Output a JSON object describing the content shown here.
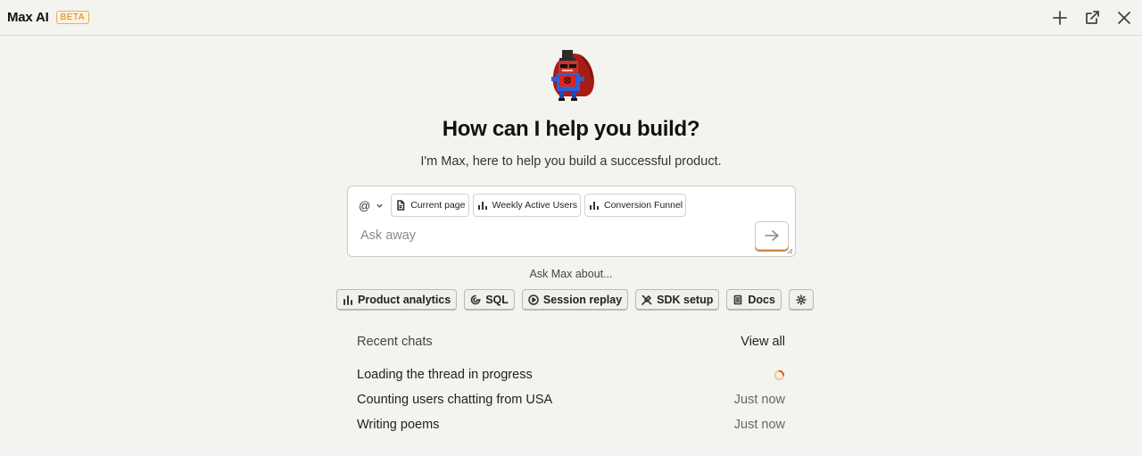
{
  "header": {
    "title": "Max AI",
    "badge": "BETA",
    "actions": [
      "plus-icon",
      "open-external-icon",
      "close-icon"
    ]
  },
  "hero": {
    "headline": "How can I help you build?",
    "subline": "I'm Max, here to help you build a successful product."
  },
  "input": {
    "mention_label": "@",
    "context_chips": [
      {
        "label": "Current page",
        "icon": "document-icon"
      },
      {
        "label": "Weekly Active Users",
        "icon": "bar-chart-icon"
      },
      {
        "label": "Conversion Funnel",
        "icon": "bar-chart-icon"
      }
    ],
    "placeholder": "Ask away"
  },
  "suggestions": {
    "heading": "Ask Max about...",
    "items": [
      {
        "label": "Product analytics",
        "icon": "bar-chart-icon"
      },
      {
        "label": "SQL",
        "icon": "database-icon"
      },
      {
        "label": "Session replay",
        "icon": "play-icon"
      },
      {
        "label": "SDK setup",
        "icon": "plug-icon"
      },
      {
        "label": "Docs",
        "icon": "book-icon"
      },
      {
        "label": "",
        "icon": "gear-icon"
      }
    ]
  },
  "recent": {
    "title": "Recent chats",
    "view_all": "View all",
    "chats": [
      {
        "name": "Loading the thread in progress",
        "time": "",
        "status": "loading"
      },
      {
        "name": "Counting users chatting from USA",
        "time": "Just now"
      },
      {
        "name": "Writing poems",
        "time": "Just now"
      }
    ]
  },
  "colors": {
    "background": "#f3f3ef",
    "accent": "#f54e00",
    "badge": "#d9830f"
  }
}
